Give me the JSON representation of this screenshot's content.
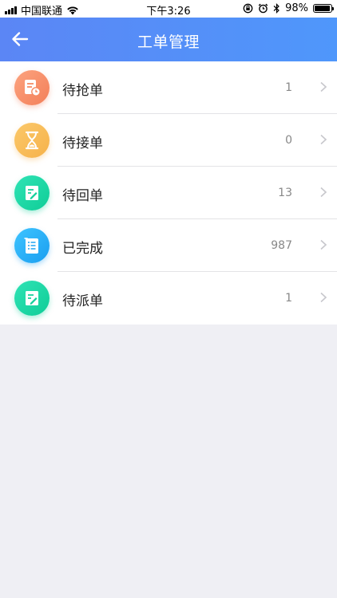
{
  "status_bar": {
    "carrier": "中国联通",
    "time": "下午3:26",
    "battery_percent": "98%",
    "battery_level": 0.98,
    "icons": [
      "signal-icon",
      "wifi-icon",
      "rotation-lock-icon",
      "alarm-icon",
      "bluetooth-icon",
      "battery-icon"
    ]
  },
  "nav": {
    "title": "工单管理",
    "back_icon": "back-arrow-icon",
    "gradient": [
      "#5b86f5",
      "#4f97fb"
    ]
  },
  "items": [
    {
      "label": "待抢单",
      "count": "1",
      "icon": "document-clock-icon",
      "colors": [
        "#fca37f",
        "#f37f59"
      ]
    },
    {
      "label": "待接单",
      "count": "0",
      "icon": "hourglass-icon",
      "colors": [
        "#fbc86a",
        "#f6b24a"
      ]
    },
    {
      "label": "待回单",
      "count": "13",
      "icon": "document-edit-icon",
      "colors": [
        "#2fe3b5",
        "#0fcd97"
      ]
    },
    {
      "label": "已完成",
      "count": "987",
      "icon": "document-list-icon",
      "colors": [
        "#3ec4ff",
        "#1a9ef0"
      ]
    },
    {
      "label": "待派单",
      "count": "1",
      "icon": "document-edit-icon",
      "colors": [
        "#2fe3b5",
        "#0fcd97"
      ]
    }
  ]
}
